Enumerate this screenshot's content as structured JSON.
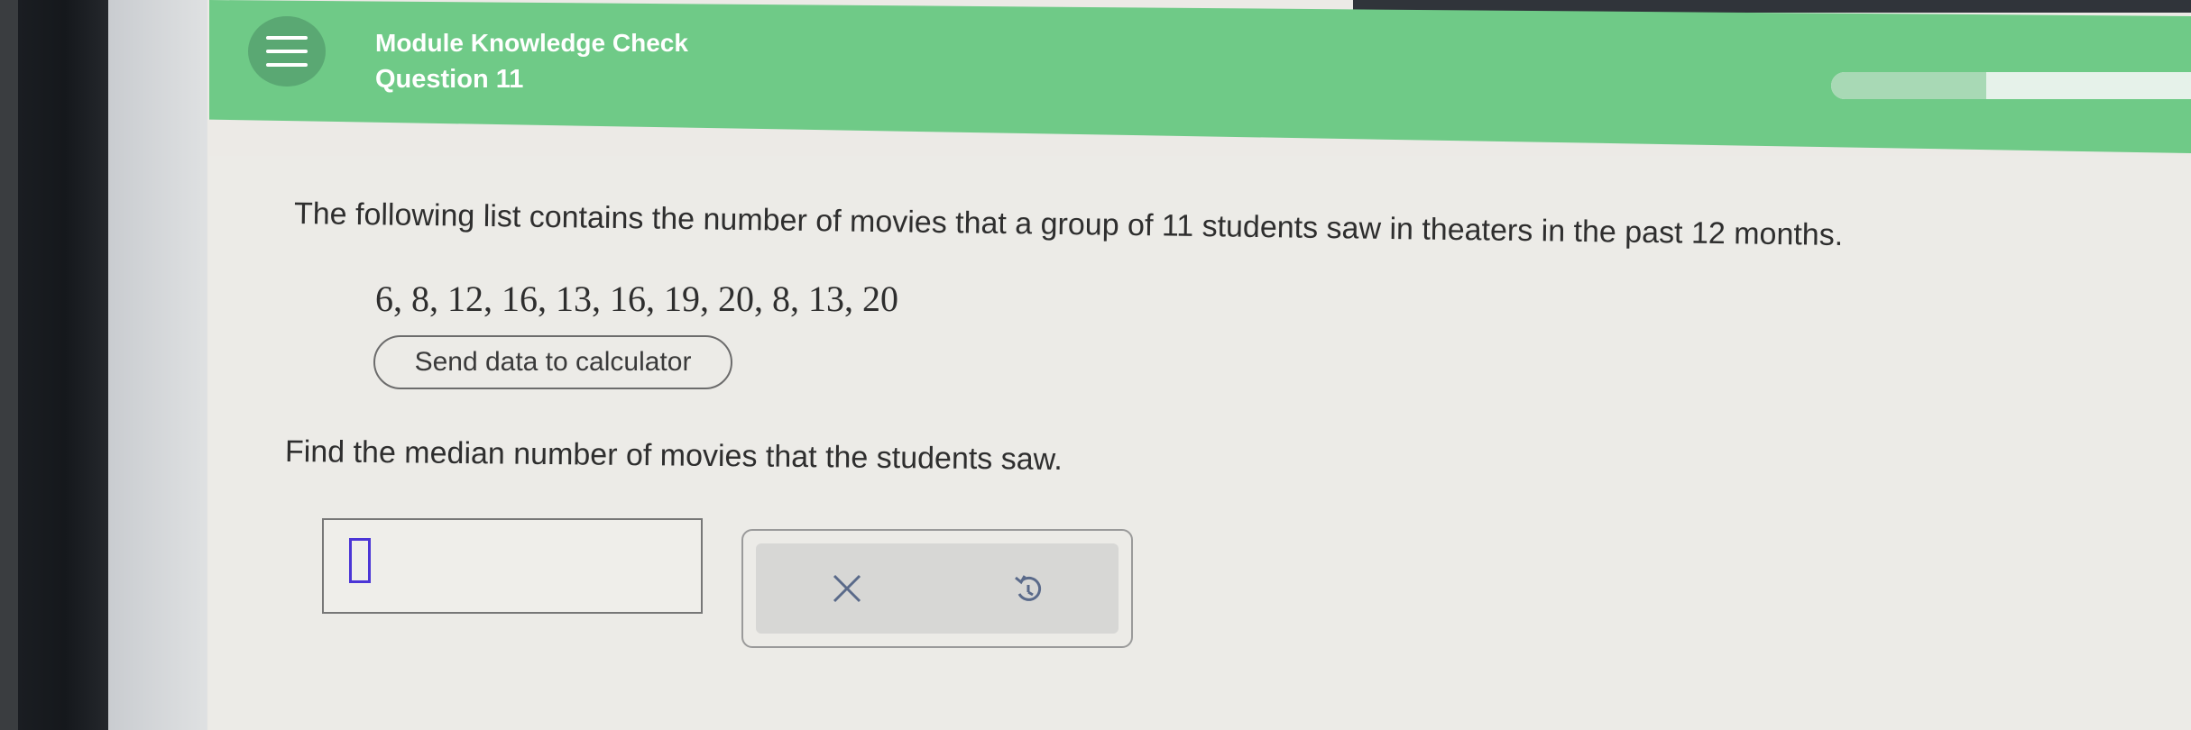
{
  "header": {
    "module_title": "Module Knowledge Check",
    "question_number": "Question 11",
    "progress_fraction": 0.43,
    "colors": {
      "header_green": "#6fca87",
      "menu_button": "#5aa873"
    }
  },
  "problem": {
    "statement": "The following list contains the number of movies that a group of 11 students saw in theaters in the past 12 months.",
    "data_values": "6, 8, 12, 16, 13, 16, 19, 20, 8, 13, 20",
    "calculator_button_label": "Send data to calculator",
    "question": "Find the median number of movies that the students saw."
  },
  "answer": {
    "value": ""
  },
  "icons": {
    "menu": "hamburger-menu-icon",
    "clear": "x-icon",
    "undo": "undo-icon"
  }
}
